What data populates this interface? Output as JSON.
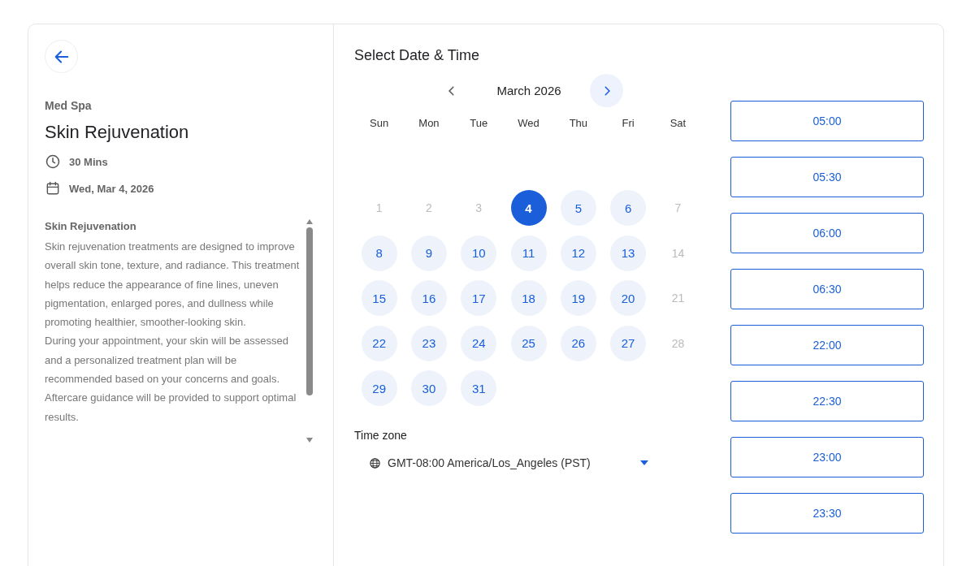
{
  "service": {
    "category": "Med Spa",
    "title": "Skin Rejuvenation",
    "duration": "30 Mins",
    "date": "Wed, Mar 4, 2026"
  },
  "description": {
    "heading": "Skin Rejuvenation",
    "paragraphs": [
      "Skin rejuvenation treatments are designed to improve overall skin tone, texture, and radiance. This treatment helps reduce the appearance of fine lines, uneven pigmentation, enlarged pores, and dullness while promoting healthier, smoother-looking skin.",
      "During your appointment, your skin will be assessed and a personalized treatment plan will be recommended based on your concerns and goals. Aftercare guidance will be provided to support optimal results."
    ]
  },
  "heading": "Select Date & Time",
  "calendar": {
    "month": "March 2026",
    "weekdays": [
      "Sun",
      "Mon",
      "Tue",
      "Wed",
      "Thu",
      "Fri",
      "Sat"
    ],
    "days": [
      {
        "label": "1",
        "disabled": true,
        "selected": false
      },
      {
        "label": "2",
        "disabled": true,
        "selected": false
      },
      {
        "label": "3",
        "disabled": true,
        "selected": false
      },
      {
        "label": "4",
        "disabled": false,
        "selected": true
      },
      {
        "label": "5",
        "disabled": false,
        "selected": false
      },
      {
        "label": "6",
        "disabled": false,
        "selected": false
      },
      {
        "label": "7",
        "disabled": true,
        "selected": false
      },
      {
        "label": "8",
        "disabled": false,
        "selected": false
      },
      {
        "label": "9",
        "disabled": false,
        "selected": false
      },
      {
        "label": "10",
        "disabled": false,
        "selected": false
      },
      {
        "label": "11",
        "disabled": false,
        "selected": false
      },
      {
        "label": "12",
        "disabled": false,
        "selected": false
      },
      {
        "label": "13",
        "disabled": false,
        "selected": false
      },
      {
        "label": "14",
        "disabled": true,
        "selected": false
      },
      {
        "label": "15",
        "disabled": false,
        "selected": false
      },
      {
        "label": "16",
        "disabled": false,
        "selected": false
      },
      {
        "label": "17",
        "disabled": false,
        "selected": false
      },
      {
        "label": "18",
        "disabled": false,
        "selected": false
      },
      {
        "label": "19",
        "disabled": false,
        "selected": false
      },
      {
        "label": "20",
        "disabled": false,
        "selected": false
      },
      {
        "label": "21",
        "disabled": true,
        "selected": false
      },
      {
        "label": "22",
        "disabled": false,
        "selected": false
      },
      {
        "label": "23",
        "disabled": false,
        "selected": false
      },
      {
        "label": "24",
        "disabled": false,
        "selected": false
      },
      {
        "label": "25",
        "disabled": false,
        "selected": false
      },
      {
        "label": "26",
        "disabled": false,
        "selected": false
      },
      {
        "label": "27",
        "disabled": false,
        "selected": false
      },
      {
        "label": "28",
        "disabled": true,
        "selected": false
      },
      {
        "label": "29",
        "disabled": false,
        "selected": false
      },
      {
        "label": "30",
        "disabled": false,
        "selected": false
      },
      {
        "label": "31",
        "disabled": false,
        "selected": false
      }
    ]
  },
  "timezone": {
    "label": "Time zone",
    "value": "GMT-08:00 America/Los_Angeles (PST)"
  },
  "slots": [
    "05:00",
    "05:30",
    "06:00",
    "06:30",
    "22:00",
    "22:30",
    "23:00",
    "23:30"
  ]
}
